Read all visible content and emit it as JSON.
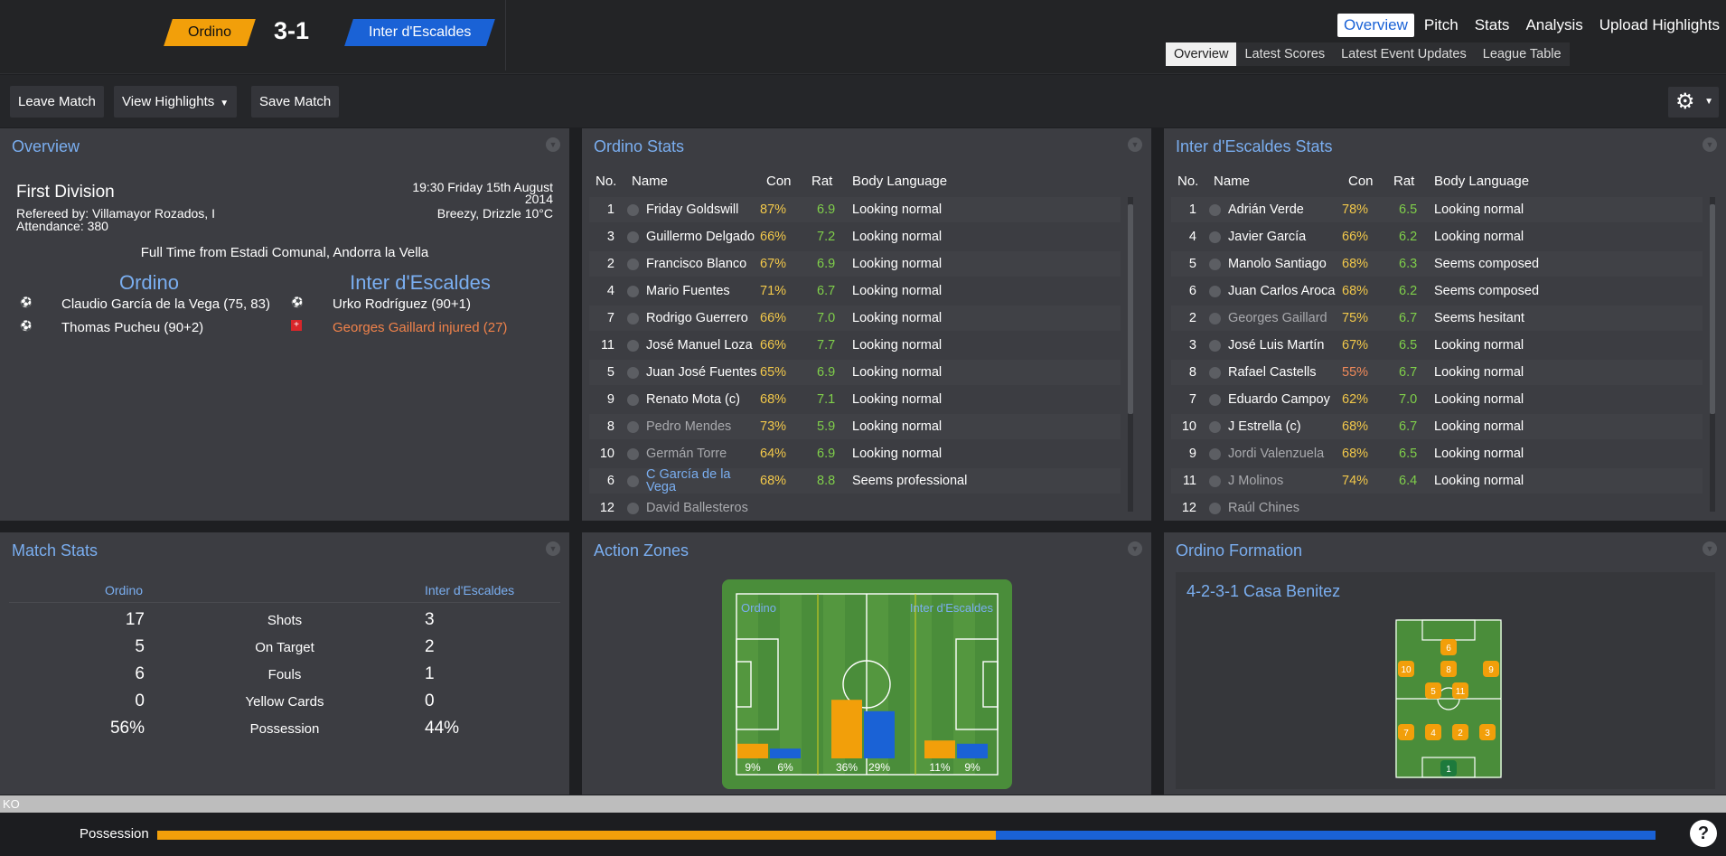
{
  "header": {
    "home_team": "Ordino",
    "away_team": "Inter d'Escaldes",
    "score": "3-1"
  },
  "nav": {
    "main": [
      "Overview",
      "Pitch",
      "Stats",
      "Analysis",
      "Upload Highlights"
    ],
    "main_active": 0,
    "sub": [
      "Overview",
      "Latest Scores",
      "Latest Event Updates",
      "League Table"
    ],
    "sub_active": 0
  },
  "toolbar": {
    "leave": "Leave Match",
    "highlights": "View Highlights",
    "save": "Save Match"
  },
  "overview": {
    "title": "Overview",
    "competition": "First Division",
    "referee": "Refereed by: Villamayor Rozados, I",
    "attendance": "Attendance: 380",
    "time": "19:30 Friday 15th August",
    "year": "2014",
    "weather": "Breezy, Drizzle 10°C",
    "fulltime": "Full Time from Estadi Comunal, Andorra la Vella",
    "home_name": "Ordino",
    "away_name": "Inter d'Escaldes",
    "home_events": [
      "Claudio García de la Vega (75, 83)",
      "Thomas Pucheu (90+2)"
    ],
    "away_events": [
      "Urko Rodríguez (90+1)",
      "Georges Gaillard injured (27)"
    ]
  },
  "home_stats": {
    "title": "Ordino Stats",
    "headers": [
      "No.",
      "Name",
      "Con",
      "Rat",
      "Body Language"
    ],
    "rows": [
      {
        "no": "1",
        "name": "Friday Goldswill",
        "con": "87%",
        "rat": "6.9",
        "bl": "Looking normal",
        "dim": false
      },
      {
        "no": "3",
        "name": "Guillermo Delgado",
        "con": "66%",
        "rat": "7.2",
        "bl": "Looking normal",
        "dim": false
      },
      {
        "no": "2",
        "name": "Francisco Blanco",
        "con": "67%",
        "rat": "6.9",
        "bl": "Looking normal",
        "dim": false
      },
      {
        "no": "4",
        "name": "Mario Fuentes",
        "con": "71%",
        "rat": "6.7",
        "bl": "Looking normal",
        "dim": false
      },
      {
        "no": "7",
        "name": "Rodrigo Guerrero",
        "con": "66%",
        "rat": "7.0",
        "bl": "Looking normal",
        "dim": false
      },
      {
        "no": "11",
        "name": "José Manuel Loza",
        "con": "66%",
        "rat": "7.7",
        "bl": "Looking normal",
        "dim": false
      },
      {
        "no": "5",
        "name": "Juan José Fuentes",
        "con": "65%",
        "rat": "6.9",
        "bl": "Looking normal",
        "dim": false
      },
      {
        "no": "9",
        "name": "Renato Mota (c)",
        "con": "68%",
        "rat": "7.1",
        "bl": "Looking normal",
        "dim": false
      },
      {
        "no": "8",
        "name": "Pedro Mendes",
        "con": "73%",
        "rat": "5.9",
        "bl": "Looking normal",
        "dim": true
      },
      {
        "no": "10",
        "name": "Germán Torre",
        "con": "64%",
        "rat": "6.9",
        "bl": "Looking normal",
        "dim": true
      },
      {
        "no": "6",
        "name": "C García de la Vega",
        "con": "68%",
        "rat": "8.8",
        "bl": "Seems professional",
        "dim": false,
        "link": true
      },
      {
        "no": "12",
        "name": "David Ballesteros",
        "con": "",
        "rat": "",
        "bl": "",
        "dim": true
      }
    ]
  },
  "away_stats": {
    "title": "Inter d'Escaldes Stats",
    "headers": [
      "No.",
      "Name",
      "Con",
      "Rat",
      "Body Language"
    ],
    "rows": [
      {
        "no": "1",
        "name": "Adrián Verde",
        "con": "78%",
        "rat": "6.5",
        "bl": "Looking normal",
        "dim": false
      },
      {
        "no": "4",
        "name": "Javier García",
        "con": "66%",
        "rat": "6.2",
        "bl": "Looking normal",
        "dim": false
      },
      {
        "no": "5",
        "name": "Manolo Santiago",
        "con": "68%",
        "rat": "6.3",
        "bl": "Seems composed",
        "dim": false
      },
      {
        "no": "6",
        "name": "Juan Carlos Aroca",
        "con": "68%",
        "rat": "6.2",
        "bl": "Seems composed",
        "dim": false
      },
      {
        "no": "2",
        "name": "Georges Gaillard",
        "con": "75%",
        "rat": "6.7",
        "bl": "Seems hesitant",
        "dim": true
      },
      {
        "no": "3",
        "name": "José Luis Martín",
        "con": "67%",
        "rat": "6.5",
        "bl": "Looking normal",
        "dim": false
      },
      {
        "no": "8",
        "name": "Rafael Castells",
        "con": "55%",
        "rat": "6.7",
        "bl": "Looking normal",
        "dim": false
      },
      {
        "no": "7",
        "name": "Eduardo Campoy",
        "con": "62%",
        "rat": "7.0",
        "bl": "Looking normal",
        "dim": false
      },
      {
        "no": "10",
        "name": "J Estrella (c)",
        "con": "68%",
        "rat": "6.7",
        "bl": "Looking normal",
        "dim": false
      },
      {
        "no": "9",
        "name": "Jordi Valenzuela",
        "con": "68%",
        "rat": "6.5",
        "bl": "Looking normal",
        "dim": true
      },
      {
        "no": "11",
        "name": "J Molinos",
        "con": "74%",
        "rat": "6.4",
        "bl": "Looking normal",
        "dim": true
      },
      {
        "no": "12",
        "name": "Raúl Chines",
        "con": "",
        "rat": "",
        "bl": "",
        "dim": true
      }
    ]
  },
  "match_stats": {
    "title": "Match Stats",
    "home": "Ordino",
    "away": "Inter d'Escaldes",
    "rows": [
      {
        "label": "Shots",
        "h": "17",
        "a": "3"
      },
      {
        "label": "On Target",
        "h": "5",
        "a": "2"
      },
      {
        "label": "Fouls",
        "h": "6",
        "a": "1"
      },
      {
        "label": "Yellow Cards",
        "h": "0",
        "a": "0"
      },
      {
        "label": "Possession",
        "h": "56%",
        "a": "44%"
      }
    ]
  },
  "zones": {
    "title": "Action Zones",
    "home": "Ordino",
    "away": "Inter d'Escaldes",
    "values": [
      {
        "home": 9,
        "away": 6,
        "home_label": "9%",
        "away_label": "6%"
      },
      {
        "home": 36,
        "away": 29,
        "home_label": "36%",
        "away_label": "29%"
      },
      {
        "home": 11,
        "away": 9,
        "home_label": "11%",
        "away_label": "9%"
      }
    ]
  },
  "formation": {
    "title": "Ordino Formation",
    "name": "4-2-3-1 Casa Benitez",
    "numbers": [
      "1",
      "7",
      "4",
      "2",
      "3",
      "5",
      "11",
      "10",
      "8",
      "9",
      "6"
    ]
  },
  "possession": {
    "label": "Possession",
    "home": 0.56,
    "ko": "KO",
    "help": "?"
  },
  "colors": {
    "home": "#f29f0a",
    "away": "#1a62d6",
    "accent": "#7aaef0",
    "pitch": "#4a8d3a"
  }
}
